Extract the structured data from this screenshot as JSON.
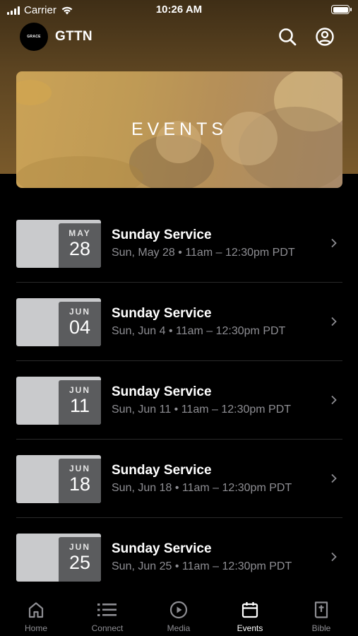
{
  "status_bar": {
    "carrier": "Carrier",
    "time": "10:26 AM"
  },
  "app_bar": {
    "logo_text": "GRACE",
    "title": "GTTN"
  },
  "banner": {
    "title": "EVENTS"
  },
  "events": [
    {
      "month": "MAY",
      "day": "28",
      "title": "Sunday Service",
      "subtitle": "Sun, May 28 • 11am – 12:30pm PDT"
    },
    {
      "month": "JUN",
      "day": "04",
      "title": "Sunday Service",
      "subtitle": "Sun, Jun 4 • 11am – 12:30pm PDT"
    },
    {
      "month": "JUN",
      "day": "11",
      "title": "Sunday Service",
      "subtitle": "Sun, Jun 11 • 11am – 12:30pm PDT"
    },
    {
      "month": "JUN",
      "day": "18",
      "title": "Sunday Service",
      "subtitle": "Sun, Jun 18 • 11am – 12:30pm PDT"
    },
    {
      "month": "JUN",
      "day": "25",
      "title": "Sunday Service",
      "subtitle": "Sun, Jun 25 • 11am – 12:30pm PDT"
    }
  ],
  "tabs": [
    {
      "label": "Home",
      "icon": "home-icon"
    },
    {
      "label": "Connect",
      "icon": "list-icon"
    },
    {
      "label": "Media",
      "icon": "play-circle-icon"
    },
    {
      "label": "Events",
      "icon": "calendar-icon",
      "active": true
    },
    {
      "label": "Bible",
      "icon": "bible-icon"
    }
  ],
  "colors": {
    "header_gradient_top": "#3f2e16",
    "header_gradient_bottom": "#7a5a2b",
    "banner_tint": "#c29a55",
    "date_badge": "#c9cacc",
    "date_box": "#5b5c5e",
    "subtitle_text": "#8e8e93"
  }
}
